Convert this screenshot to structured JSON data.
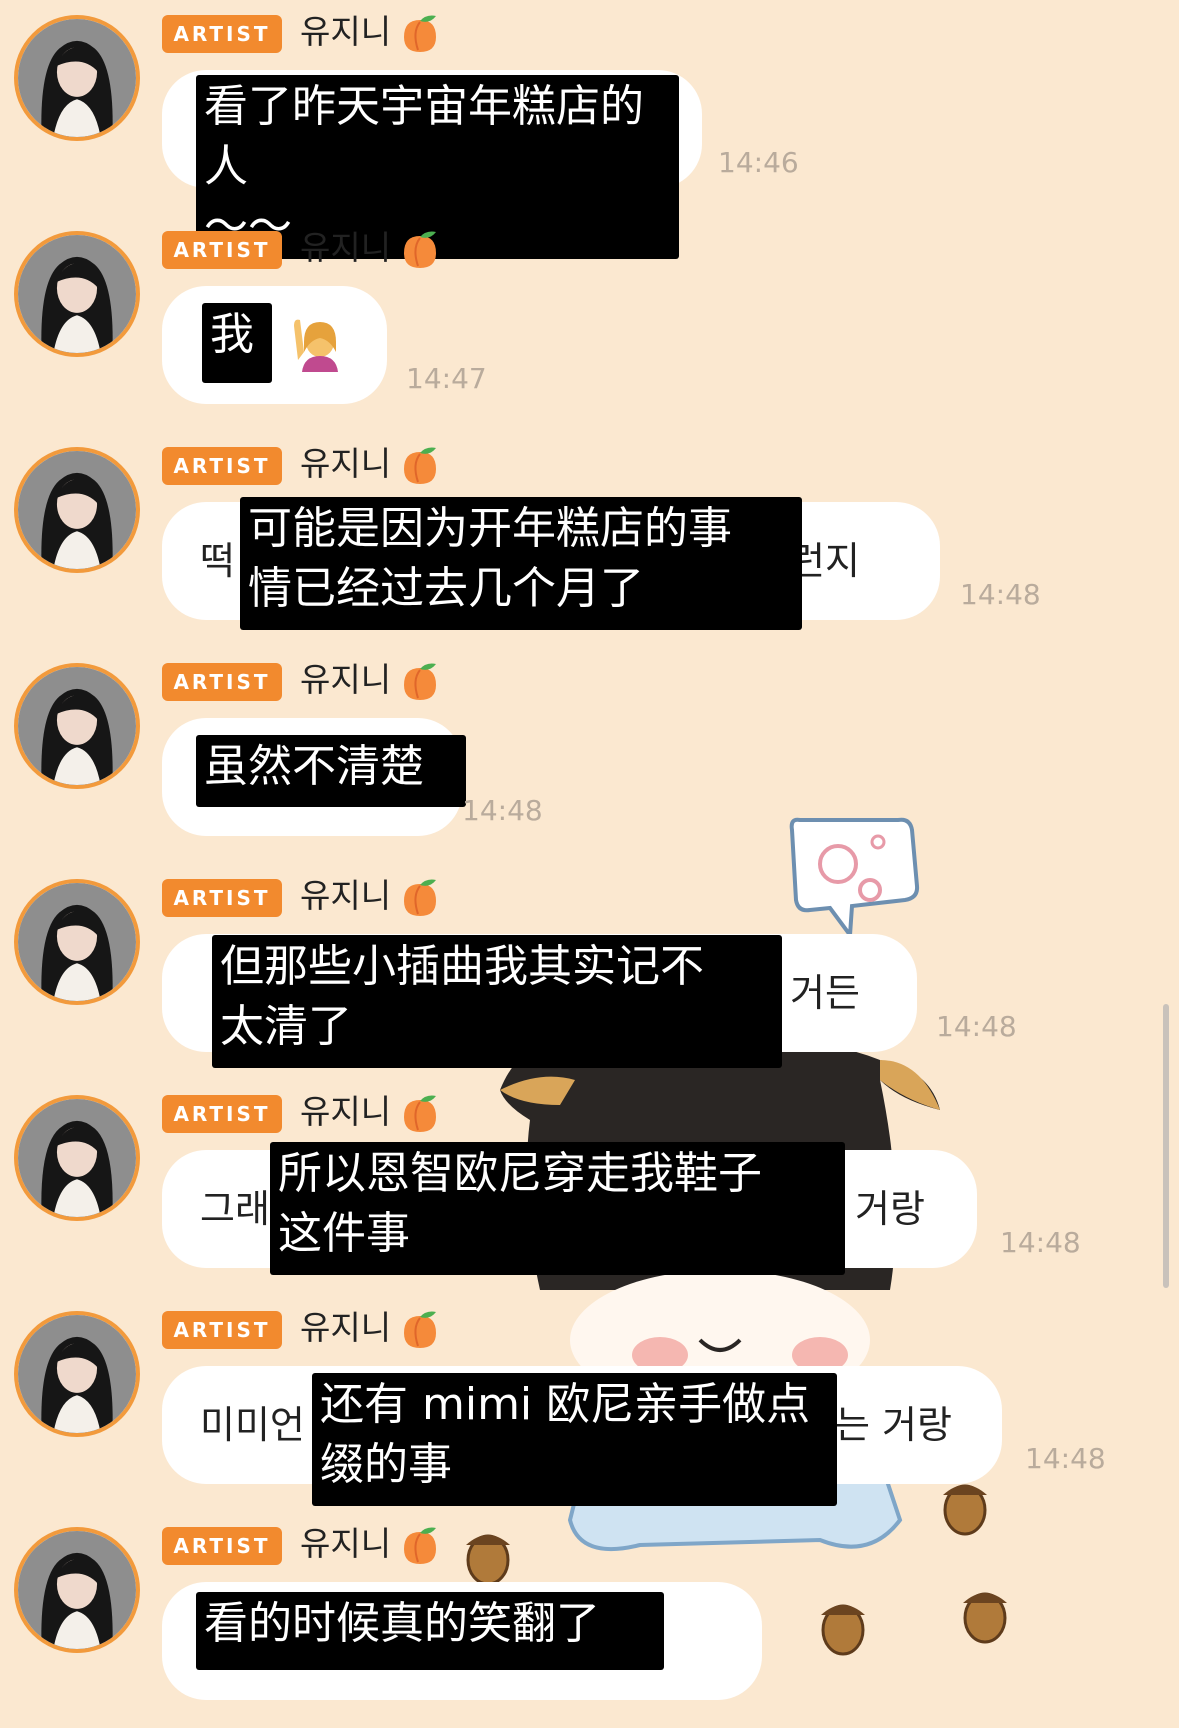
{
  "badge_label": "ARTIST",
  "sender_name": "유지니",
  "messages": [
    {
      "overlay": "看了昨天宇宙年糕店的人\n～～",
      "korean_left": "",
      "korean_right": "",
      "time": "14:46"
    },
    {
      "overlay": "我",
      "korean_left": "",
      "korean_right": "",
      "time": "14:47"
    },
    {
      "overlay": "可能是因为开年糕店的事\n情已经过去几个月了",
      "korean_left": "떡",
      "korean_right": "런지",
      "time": "14:48"
    },
    {
      "overlay": "虽然不清楚",
      "korean_left": "",
      "korean_right": "",
      "time": "14:48"
    },
    {
      "overlay": "但那些小插曲我其实记不\n太清了",
      "korean_left": "",
      "korean_right": "거든",
      "time": "14:48"
    },
    {
      "overlay": "所以恩智欧尼穿走我鞋子\n这件事",
      "korean_left": "그래",
      "korean_right": "거랑",
      "time": "14:48"
    },
    {
      "overlay": "还有 mimi 欧尼亲手做点\n缀的事",
      "korean_left": "미미언",
      "korean_right": "는 거랑",
      "time": "14:48"
    },
    {
      "overlay": "看的时候真的笑翻了",
      "korean_left": "",
      "korean_right": "",
      "time": ""
    }
  ]
}
